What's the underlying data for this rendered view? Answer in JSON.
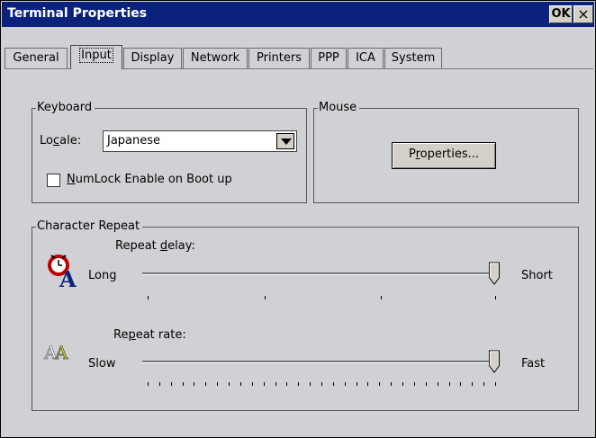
{
  "window": {
    "title": "Terminal Properties",
    "ok_label": "OK",
    "close_label": "×"
  },
  "tabs": [
    "General",
    "Input",
    "Display",
    "Network",
    "Printers",
    "PPP",
    "ICA",
    "System"
  ],
  "active_tab": "Input",
  "keyboard": {
    "group_label": "Keyboard",
    "locale_label_pre": "Lo",
    "locale_label_ul": "c",
    "locale_label_post": "ale:",
    "locale_value": "Japanese",
    "numlock_pre": "",
    "numlock_ul": "N",
    "numlock_post": "umLock Enable on Boot up",
    "numlock_checked": false
  },
  "mouse": {
    "group_label": "Mouse",
    "button_pre": "P",
    "button_ul": "r",
    "button_post": "operties..."
  },
  "char_repeat": {
    "group_label": "Character Repeat",
    "delay_pre": "Repeat ",
    "delay_ul": "d",
    "delay_post": "elay:",
    "delay_min": "Long",
    "delay_max": "Short",
    "delay_value_fraction": 1.0,
    "rate_pre": "Re",
    "rate_ul": "p",
    "rate_post": "eat rate:",
    "rate_min": "Slow",
    "rate_max": "Fast",
    "rate_value_fraction": 1.0
  },
  "colors": {
    "titlebar": "#0a217d",
    "face": "#cfd1d5"
  },
  "icons": {
    "delay": "alarm-clock-letter-icon",
    "rate": "double-letter-icon"
  }
}
